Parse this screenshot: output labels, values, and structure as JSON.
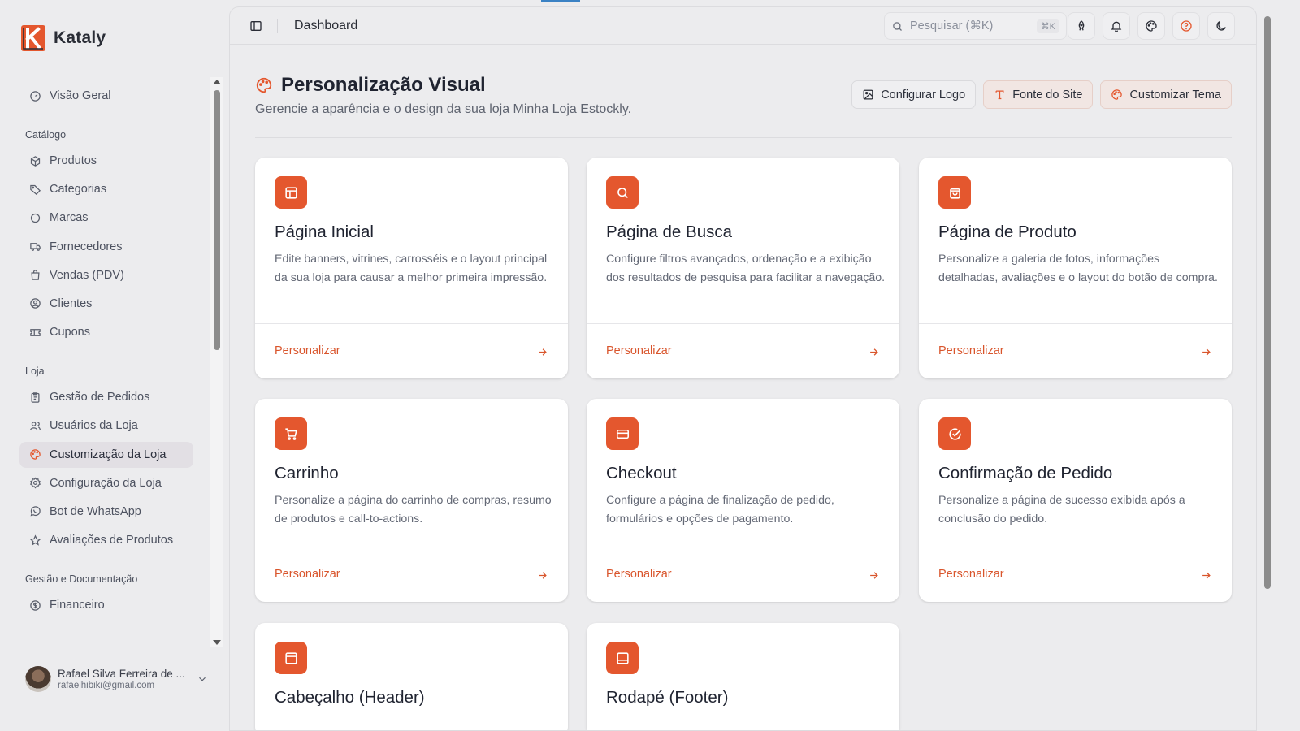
{
  "brand": {
    "name": "Kataly"
  },
  "sidebar": {
    "top_items": [
      {
        "label": "Visão Geral",
        "icon": "gauge-icon"
      }
    ],
    "sections": [
      {
        "title": "Catálogo",
        "items": [
          {
            "label": "Produtos",
            "icon": "package-icon"
          },
          {
            "label": "Categorias",
            "icon": "tag-icon"
          },
          {
            "label": "Marcas",
            "icon": "circle-icon"
          },
          {
            "label": "Fornecedores",
            "icon": "truck-icon"
          },
          {
            "label": "Vendas (PDV)",
            "icon": "shopping-bag-icon"
          },
          {
            "label": "Clientes",
            "icon": "user-circle-icon"
          },
          {
            "label": "Cupons",
            "icon": "ticket-icon"
          }
        ]
      },
      {
        "title": "Loja",
        "items": [
          {
            "label": "Gestão de Pedidos",
            "icon": "clipboard-icon"
          },
          {
            "label": "Usuários da Loja",
            "icon": "users-icon"
          },
          {
            "label": "Customização da Loja",
            "icon": "palette-icon",
            "active": true
          },
          {
            "label": "Configuração da Loja",
            "icon": "gear-icon"
          },
          {
            "label": "Bot de WhatsApp",
            "icon": "whatsapp-icon"
          },
          {
            "label": "Avaliações de Produtos",
            "icon": "star-icon"
          }
        ]
      },
      {
        "title": "Gestão e Documentação",
        "items": [
          {
            "label": "Financeiro",
            "icon": "dollar-circle-icon"
          }
        ]
      }
    ]
  },
  "user": {
    "name": "Rafael Silva Ferreira de ...",
    "email": "rafaelhibiki@gmail.com"
  },
  "topbar": {
    "title": "Dashboard",
    "search_placeholder": "Pesquisar (⌘K)",
    "shortcut": "⌘K"
  },
  "header": {
    "title": "Personalização Visual",
    "subtitle": "Gerencie a aparência e o design da sua loja Minha Loja Estockly.",
    "actions": {
      "logo": "Configurar Logo",
      "font": "Fonte do Site",
      "theme": "Customizar Tema"
    }
  },
  "cards": [
    {
      "title": "Página Inicial",
      "desc": "Edite banners, vitrines, carrosséis e o layout principal da sua loja para causar a melhor primeira impressão.",
      "link": "Personalizar",
      "icon": "layout-icon"
    },
    {
      "title": "Página de Busca",
      "desc": "Configure filtros avançados, ordenação e a exibição dos resultados de pesquisa para facilitar a navegação.",
      "link": "Personalizar",
      "icon": "search-icon"
    },
    {
      "title": "Página de Produto",
      "desc": "Personalize a galeria de fotos, informações detalhadas, avaliações e o layout do botão de compra.",
      "link": "Personalizar",
      "icon": "shopping-bag-icon"
    },
    {
      "title": "Carrinho",
      "desc": "Personalize a página do carrinho de compras, resumo de produtos e call-to-actions.",
      "link": "Personalizar",
      "icon": "cart-icon"
    },
    {
      "title": "Checkout",
      "desc": "Configure a página de finalização de pedido, formulários e opções de pagamento.",
      "link": "Personalizar",
      "icon": "credit-card-icon"
    },
    {
      "title": "Confirmação de Pedido",
      "desc": "Personalize a página de sucesso exibida após a conclusão do pedido.",
      "link": "Personalizar",
      "icon": "check-circle-icon"
    },
    {
      "title": "Cabeçalho (Header)",
      "desc": "",
      "link": "",
      "icon": "header-layout-icon"
    },
    {
      "title": "Rodapé (Footer)",
      "desc": "",
      "link": "",
      "icon": "footer-layout-icon"
    }
  ],
  "colors": {
    "accent": "#e4572e",
    "link": "#d9552c",
    "background": "#ececee",
    "card": "#ffffff"
  }
}
